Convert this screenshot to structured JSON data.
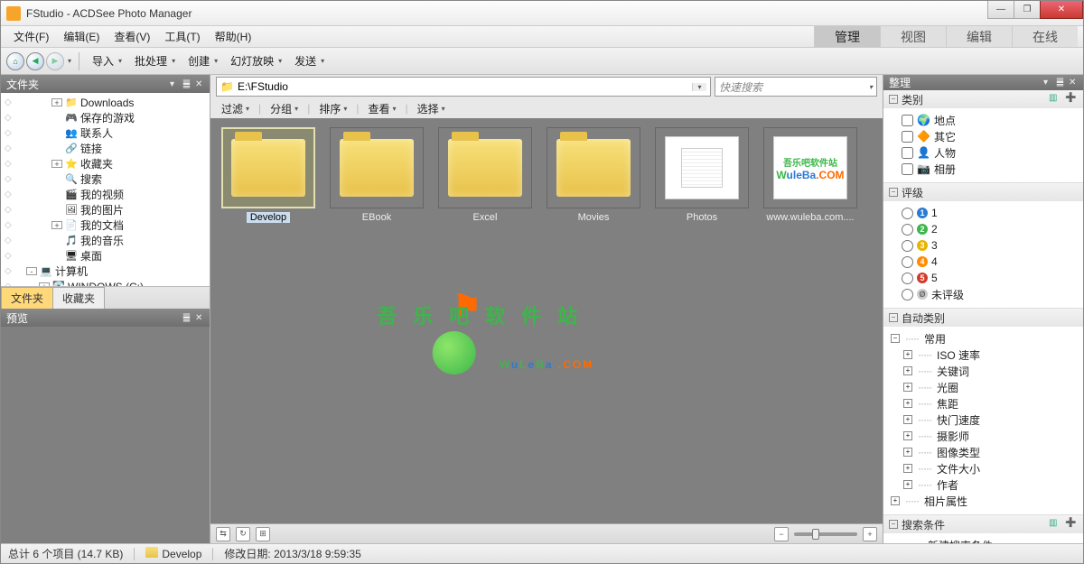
{
  "title": "FStudio - ACDSee Photo Manager",
  "menus": [
    "文件(F)",
    "编辑(E)",
    "查看(V)",
    "工具(T)",
    "帮助(H)"
  ],
  "modes": [
    {
      "label": "管理",
      "active": true
    },
    {
      "label": "视图",
      "active": false
    },
    {
      "label": "编辑",
      "active": false
    },
    {
      "label": "在线",
      "active": false
    }
  ],
  "toolbar": [
    "导入",
    "批处理",
    "创建",
    "幻灯放映",
    "发送"
  ],
  "left": {
    "folders_title": "文件夹",
    "fav_tab": "收藏夹",
    "preview_title": "预览",
    "tree": [
      {
        "indent": 3,
        "exp": "+",
        "icon": "📁",
        "label": "Downloads"
      },
      {
        "indent": 3,
        "exp": "",
        "icon": "🎮",
        "label": "保存的游戏"
      },
      {
        "indent": 3,
        "exp": "",
        "icon": "👥",
        "label": "联系人"
      },
      {
        "indent": 3,
        "exp": "",
        "icon": "🔗",
        "label": "链接"
      },
      {
        "indent": 3,
        "exp": "+",
        "icon": "⭐",
        "label": "收藏夹"
      },
      {
        "indent": 3,
        "exp": "",
        "icon": "🔍",
        "label": "搜索"
      },
      {
        "indent": 3,
        "exp": "",
        "icon": "🎬",
        "label": "我的视频"
      },
      {
        "indent": 3,
        "exp": "",
        "icon": "🖼",
        "label": "我的图片"
      },
      {
        "indent": 3,
        "exp": "+",
        "icon": "📄",
        "label": "我的文档"
      },
      {
        "indent": 3,
        "exp": "",
        "icon": "🎵",
        "label": "我的音乐"
      },
      {
        "indent": 3,
        "exp": "",
        "icon": "🖥",
        "label": "桌面"
      },
      {
        "indent": 1,
        "exp": "-",
        "icon": "💻",
        "label": "计算机"
      },
      {
        "indent": 2,
        "exp": "+",
        "icon": "💽",
        "label": "WINDOWS (C:)"
      }
    ]
  },
  "path": "E:\\FStudio",
  "search_placeholder": "快速搜索",
  "filters": [
    "过滤",
    "分组",
    "排序",
    "查看",
    "选择"
  ],
  "thumbs": [
    {
      "type": "folder",
      "label": "Develop",
      "sel": true
    },
    {
      "type": "folder",
      "label": "EBook"
    },
    {
      "type": "folder",
      "label": "Excel"
    },
    {
      "type": "folder",
      "label": "Movies"
    },
    {
      "type": "file",
      "label": "Photos",
      "preview": "doc"
    },
    {
      "type": "file",
      "label": "www.wuleba.com....",
      "preview": "logo"
    }
  ],
  "organize": {
    "title": "整理",
    "categories": {
      "title": "类别",
      "items": [
        "地点",
        "其它",
        "人物",
        "相册"
      ],
      "icons": [
        "🌍",
        "🔶",
        "👤",
        "📷"
      ]
    },
    "ratings": {
      "title": "评级",
      "items": [
        {
          "n": "1",
          "color": "#2a7ad4"
        },
        {
          "n": "2",
          "color": "#3cb64a"
        },
        {
          "n": "3",
          "color": "#e8b400"
        },
        {
          "n": "4",
          "color": "#ff8a00"
        },
        {
          "n": "5",
          "color": "#d43a2a"
        }
      ],
      "unrated": "未评级"
    },
    "auto": {
      "title": "自动类别",
      "common": "常用",
      "items": [
        "ISO 速率",
        "关键词",
        "光圈",
        "焦距",
        "快门速度",
        "摄影师",
        "图像类型",
        "文件大小",
        "作者"
      ],
      "photo_attr": "相片属性"
    },
    "search": {
      "title": "搜索条件",
      "new": "新建搜索条件"
    }
  },
  "status": {
    "count": "总计 6 个项目 (14.7 KB)",
    "sel_folder": "Develop",
    "modified": "修改日期: 2013/3/18 9:59:35"
  }
}
